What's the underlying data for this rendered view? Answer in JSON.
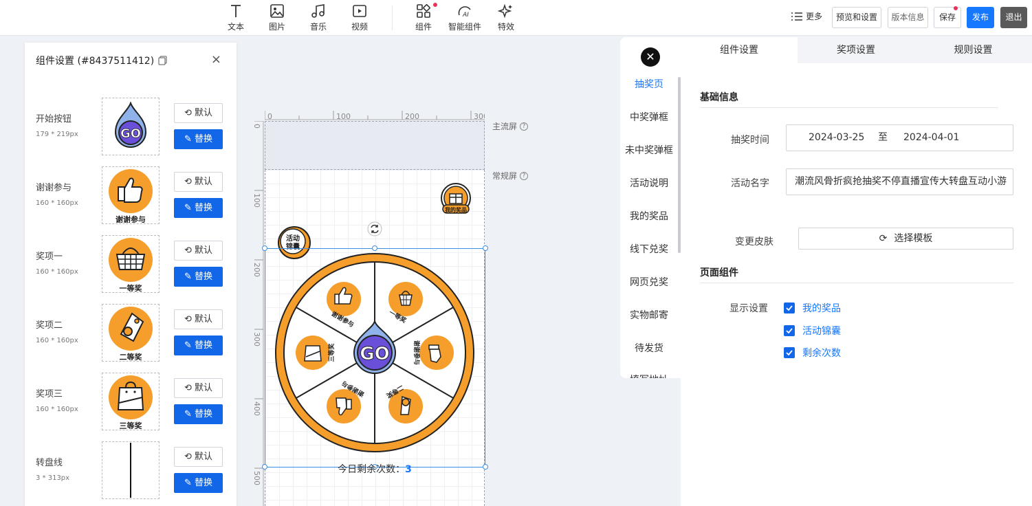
{
  "toolbar": {
    "items": [
      {
        "label": "文本",
        "icon": "text-icon"
      },
      {
        "label": "图片",
        "icon": "image-icon"
      },
      {
        "label": "音乐",
        "icon": "music-icon"
      },
      {
        "label": "视频",
        "icon": "video-icon"
      },
      {
        "label": "组件",
        "icon": "components-icon"
      },
      {
        "label": "智能组件",
        "icon": "ai-icon"
      },
      {
        "label": "特效",
        "icon": "sparkle-icon"
      }
    ],
    "more": "更多",
    "preview": "预览和设置",
    "version": "版本信息",
    "save": "保存",
    "publish": "发布",
    "exit": "退出",
    "accent": "#1677ff"
  },
  "left_panel": {
    "title": "组件设置 (#8437511412)",
    "default_label": "默认",
    "replace_label": "替换",
    "components": [
      {
        "name": "开始按钮",
        "size": "179 * 219px",
        "thumb": "go-button-icon"
      },
      {
        "name": "谢谢参与",
        "size": "160 * 160px",
        "thumb": "thumbs-up-icon",
        "caption": "谢谢参与"
      },
      {
        "name": "奖项一",
        "size": "160 * 160px",
        "thumb": "basket-icon",
        "caption": "一等奖"
      },
      {
        "name": "奖项二",
        "size": "160 * 160px",
        "thumb": "tag-icon",
        "caption": "二等奖"
      },
      {
        "name": "奖项三",
        "size": "160 * 160px",
        "thumb": "bag-icon",
        "caption": "三等奖"
      },
      {
        "name": "转盘线",
        "size": "3 * 313px",
        "thumb": "line-icon"
      }
    ]
  },
  "canvas": {
    "ruler_h": [
      "0",
      "100",
      "200",
      "300"
    ],
    "ruler_v": [
      "0",
      "100",
      "200",
      "300",
      "400",
      "500"
    ],
    "main_screen_label": "主流屏",
    "normal_screen_label": "常规屏",
    "my_prize_badge": "我的奖品",
    "activity_badge_line1": "活动",
    "activity_badge_line2": "锦囊",
    "go_text": "GO",
    "wheel_labels": [
      "谢谢参与",
      "一等奖",
      "谢谢参与",
      "二等奖",
      "谢谢参与",
      "三等奖"
    ],
    "remain_label": "今日剩余次数：",
    "remain_value": "3",
    "wheel_orange": "#f59e2b"
  },
  "page_list": {
    "items": [
      "抽奖页",
      "中奖弹框",
      "未中奖弹框",
      "活动说明",
      "我的奖品",
      "线下兑奖",
      "网页兑奖",
      "实物邮寄",
      "待发货",
      "填写地址"
    ],
    "active": "抽奖页"
  },
  "settings": {
    "tabs": [
      "组件设置",
      "奖项设置",
      "规则设置"
    ],
    "basic_title": "基础信息",
    "time_label": "抽奖时间",
    "start_date": "2024-03-25",
    "to": "至",
    "end_date": "2024-04-01",
    "name_label": "活动名字",
    "name_value": "潮流风骨折疯抢抽奖不停直播宣传大转盘互动小游",
    "skin_label": "变更皮肤",
    "skin_button": "选择模板",
    "components_title": "页面组件",
    "display_label": "显示设置",
    "checks": [
      "我的奖品",
      "活动锦囊",
      "剩余次数"
    ]
  }
}
